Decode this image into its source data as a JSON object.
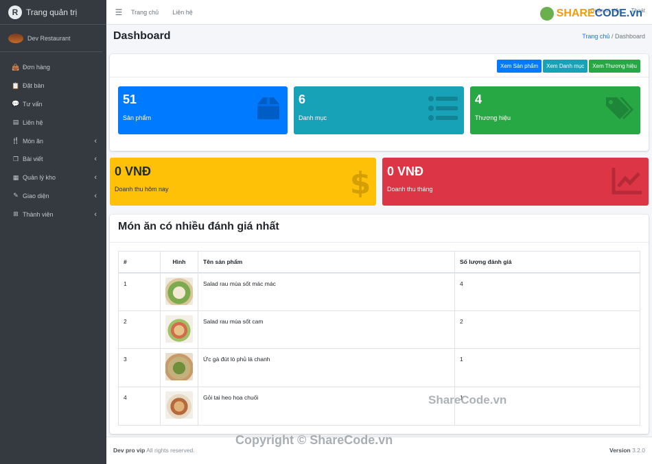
{
  "sidebar": {
    "brand": "Trang quản trị",
    "brand_logo_letter": "R",
    "user": "Dev Restaurant",
    "items": [
      {
        "label": "Đơn hàng",
        "icon": "shopping-bag-icon",
        "icon_char": "👜",
        "caret": false
      },
      {
        "label": "Đặt bàn",
        "icon": "clipboard-icon",
        "icon_char": "📋",
        "caret": false
      },
      {
        "label": "Tư vấn",
        "icon": "chat-icon",
        "icon_char": "💬",
        "caret": false
      },
      {
        "label": "Liên hệ",
        "icon": "address-card-icon",
        "icon_char": "▤",
        "caret": false
      },
      {
        "label": "Món ăn",
        "icon": "utensils-icon",
        "icon_char": "🍴",
        "caret": true
      },
      {
        "label": "Bài viết",
        "icon": "copy-icon",
        "icon_char": "❐",
        "caret": true
      },
      {
        "label": "Quản lý kho",
        "icon": "warehouse-icon",
        "icon_char": "▦",
        "caret": true
      },
      {
        "label": "Giao diện",
        "icon": "edit-icon",
        "icon_char": "✎",
        "caret": true
      },
      {
        "label": "Thành viên",
        "icon": "table-icon",
        "icon_char": "⊞",
        "caret": true
      }
    ]
  },
  "navbar": {
    "links": [
      "Trang chủ",
      "Liên hệ"
    ],
    "right": [
      "Quản trị viên",
      "Thoát"
    ],
    "watermark_share": "SHARE",
    "watermark_code": "CODE.vn"
  },
  "header": {
    "title": "Dashboard",
    "breadcrumb_home": "Trang chủ",
    "breadcrumb_sep": "/",
    "breadcrumb_current": "Dashboard"
  },
  "buttons": {
    "view_products": "Xem Sản phẩm",
    "view_categories": "Xem Danh mục",
    "view_brands": "Xem Thương hiệu"
  },
  "stats": [
    {
      "value": "51",
      "label": "Sản phẩm",
      "color": "#007bff",
      "icon": "box-icon"
    },
    {
      "value": "6",
      "label": "Danh mục",
      "color": "#17a2b8",
      "icon": "list-icon"
    },
    {
      "value": "4",
      "label": "Thương hiệu",
      "color": "#28a745",
      "icon": "tags-icon"
    },
    {
      "value": "0 VNĐ",
      "label": "Doanh thu hôm nay",
      "color": "#ffc107",
      "icon": "dollar-icon"
    },
    {
      "value": "0 VNĐ",
      "label": "Doanh thu tháng",
      "color": "#dc3545",
      "icon": "line-chart-icon"
    }
  ],
  "top_rated": {
    "title": "Món ăn có nhiều đánh giá nhất",
    "headers": [
      "#",
      "Hình",
      "Tên sản phẩm",
      "Số lượng đánh giá"
    ],
    "rows": [
      {
        "no": "1",
        "name": "Salad rau mùa sốt mác mác",
        "count": "4"
      },
      {
        "no": "2",
        "name": "Salad rau mùa sốt cam",
        "count": "2"
      },
      {
        "no": "3",
        "name": "Ức gà đút lò phủ lá chanh",
        "count": "1"
      },
      {
        "no": "4",
        "name": "Gỏi tai heo hoa chuối",
        "count": "1"
      }
    ]
  },
  "footer": {
    "brand": "Dev pro vip",
    "rights": " All rights reserved.",
    "version_label": "Version",
    "version": " 3.2.0"
  },
  "watermarks": {
    "middle": "ShareCode.vn",
    "bottom": "Copyright © ShareCode.vn"
  }
}
